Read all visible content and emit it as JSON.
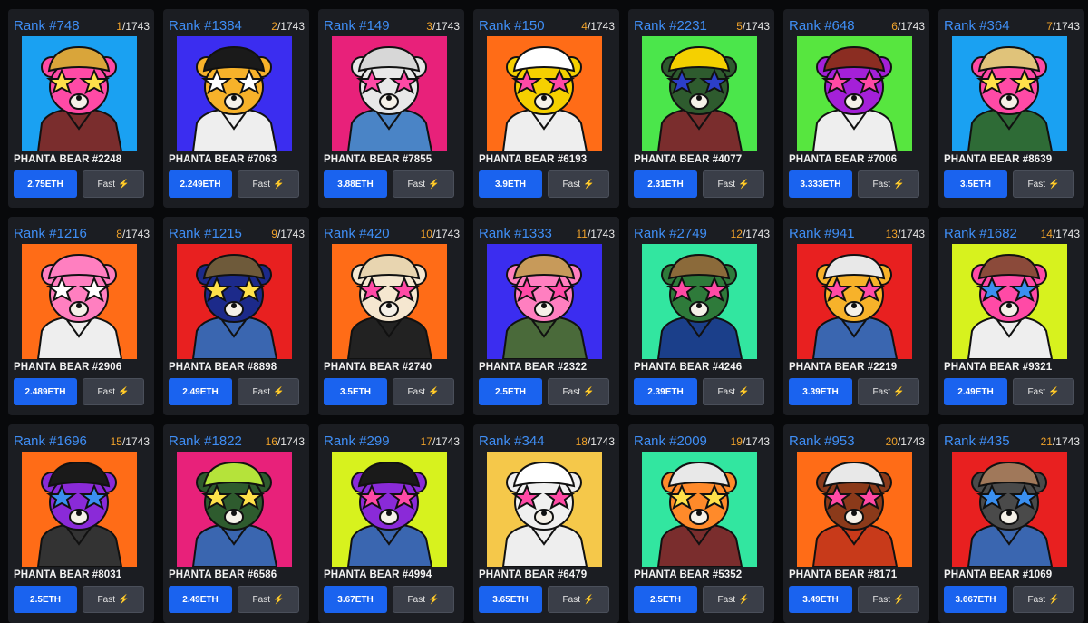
{
  "fast_label": "Fast",
  "fast_icon": "⚡",
  "total": "1743",
  "cards": [
    {
      "rank": "Rank #748",
      "pos": "1",
      "name": "PHANTA BEAR #2248",
      "price": "2.75ETH",
      "bg": "#1aa1f2",
      "head": "#ff4aa6",
      "cap": "#d9a53a",
      "glass": "#ffe14a",
      "body": "#7a2d2d"
    },
    {
      "rank": "Rank #1384",
      "pos": "2",
      "name": "PHANTA BEAR #7063",
      "price": "2.249ETH",
      "bg": "#3b2df0",
      "head": "#f7b22a",
      "cap": "#1a1a1a",
      "glass": "#ffffff",
      "body": "#eeeeee"
    },
    {
      "rank": "Rank #149",
      "pos": "3",
      "name": "PHANTA BEAR #7855",
      "price": "3.88ETH",
      "bg": "#e8217a",
      "head": "#e8e8e8",
      "cap": "#d7d7d7",
      "glass": "#ff4aa6",
      "body": "#4a84c6"
    },
    {
      "rank": "Rank #150",
      "pos": "4",
      "name": "PHANTA BEAR #6193",
      "price": "3.9ETH",
      "bg": "#ff6c17",
      "head": "#f5d000",
      "cap": "#ffffff",
      "glass": "#ff4aa6",
      "body": "#eeeeee"
    },
    {
      "rank": "Rank #2231",
      "pos": "5",
      "name": "PHANTA BEAR #4077",
      "price": "2.31ETH",
      "bg": "#4be64b",
      "head": "#2e5b2e",
      "cap": "#f5d000",
      "glass": "#2c3fc9",
      "body": "#7a2d2d"
    },
    {
      "rank": "Rank #648",
      "pos": "6",
      "name": "PHANTA BEAR #7006",
      "price": "3.333ETH",
      "bg": "#57e63f",
      "head": "#a420d8",
      "cap": "#8b2d22",
      "glass": "#ff4aa6",
      "body": "#eeeeee"
    },
    {
      "rank": "Rank #364",
      "pos": "7",
      "name": "PHANTA BEAR #8639",
      "price": "3.5ETH",
      "bg": "#1aa1f2",
      "head": "#ff4aa6",
      "cap": "#e0c37a",
      "glass": "#ffe14a",
      "body": "#2e6b36"
    },
    {
      "rank": "Rank #1216",
      "pos": "8",
      "name": "PHANTA BEAR #2906",
      "price": "2.489ETH",
      "bg": "#ff6c17",
      "head": "#ff7fc0",
      "cap": "#ff7fc0",
      "glass": "#ffffff",
      "body": "#eeeeee"
    },
    {
      "rank": "Rank #1215",
      "pos": "9",
      "name": "PHANTA BEAR #8898",
      "price": "2.49ETH",
      "bg": "#e82020",
      "head": "#1c2a8a",
      "cap": "#6e5a3a",
      "glass": "#ffe14a",
      "body": "#3a66b0"
    },
    {
      "rank": "Rank #420",
      "pos": "10",
      "name": "PHANTA BEAR #2740",
      "price": "3.5ETH",
      "bg": "#ff6c17",
      "head": "#f5e7d0",
      "cap": "#e8d5b0",
      "glass": "#ff4aa6",
      "body": "#222222"
    },
    {
      "rank": "Rank #1333",
      "pos": "11",
      "name": "PHANTA BEAR #2322",
      "price": "2.5ETH",
      "bg": "#3b2df0",
      "head": "#ff7fc0",
      "cap": "#c79a5a",
      "glass": "#ff4aa6",
      "body": "#4a6a3a"
    },
    {
      "rank": "Rank #2749",
      "pos": "12",
      "name": "PHANTA BEAR #4246",
      "price": "2.39ETH",
      "bg": "#32e6a0",
      "head": "#2e7a3a",
      "cap": "#8b6a3a",
      "glass": "#ff4aa6",
      "body": "#1b3f8a"
    },
    {
      "rank": "Rank #941",
      "pos": "13",
      "name": "PHANTA BEAR #2219",
      "price": "3.39ETH",
      "bg": "#e82020",
      "head": "#f7b22a",
      "cap": "#e8e8e8",
      "glass": "#ff4aa6",
      "body": "#3a66b0"
    },
    {
      "rank": "Rank #1682",
      "pos": "14",
      "name": "PHANTA BEAR #9321",
      "price": "2.49ETH",
      "bg": "#d7f21e",
      "head": "#ff4aa6",
      "cap": "#8b4a3a",
      "glass": "#3a8ff0",
      "body": "#eeeeee"
    },
    {
      "rank": "Rank #1696",
      "pos": "15",
      "name": "PHANTA BEAR #8031",
      "price": "2.5ETH",
      "bg": "#ff6c17",
      "head": "#8a2ad8",
      "cap": "#1a1a1a",
      "glass": "#3a8ff0",
      "body": "#333333"
    },
    {
      "rank": "Rank #1822",
      "pos": "16",
      "name": "PHANTA BEAR #6586",
      "price": "2.49ETH",
      "bg": "#e8217a",
      "head": "#2e5b2e",
      "cap": "#b5e33a",
      "glass": "#ffe14a",
      "body": "#3a66b0"
    },
    {
      "rank": "Rank #299",
      "pos": "17",
      "name": "PHANTA BEAR #4994",
      "price": "3.67ETH",
      "bg": "#d7f21e",
      "head": "#8a2ad8",
      "cap": "#1a1a1a",
      "glass": "#ff4aa6",
      "body": "#3a66b0"
    },
    {
      "rank": "Rank #344",
      "pos": "18",
      "name": "PHANTA BEAR #6479",
      "price": "3.65ETH",
      "bg": "#f5c84a",
      "head": "#f0f0f0",
      "cap": "#ffffff",
      "glass": "#ff4aa6",
      "body": "#eeeeee"
    },
    {
      "rank": "Rank #2009",
      "pos": "19",
      "name": "PHANTA BEAR #5352",
      "price": "2.5ETH",
      "bg": "#32e6a0",
      "head": "#ff8a2a",
      "cap": "#e8e8e8",
      "glass": "#ffe14a",
      "body": "#7a2d2d"
    },
    {
      "rank": "Rank #953",
      "pos": "20",
      "name": "PHANTA BEAR #8171",
      "price": "3.49ETH",
      "bg": "#ff6c17",
      "head": "#8b3a1a",
      "cap": "#e8e8e8",
      "glass": "#ff4aa6",
      "body": "#c83a1a"
    },
    {
      "rank": "Rank #435",
      "pos": "21",
      "name": "PHANTA BEAR #1069",
      "price": "3.667ETH",
      "bg": "#e82020",
      "head": "#4a4a4a",
      "cap": "#a0785a",
      "glass": "#3a8ff0",
      "body": "#3a66b0"
    }
  ]
}
